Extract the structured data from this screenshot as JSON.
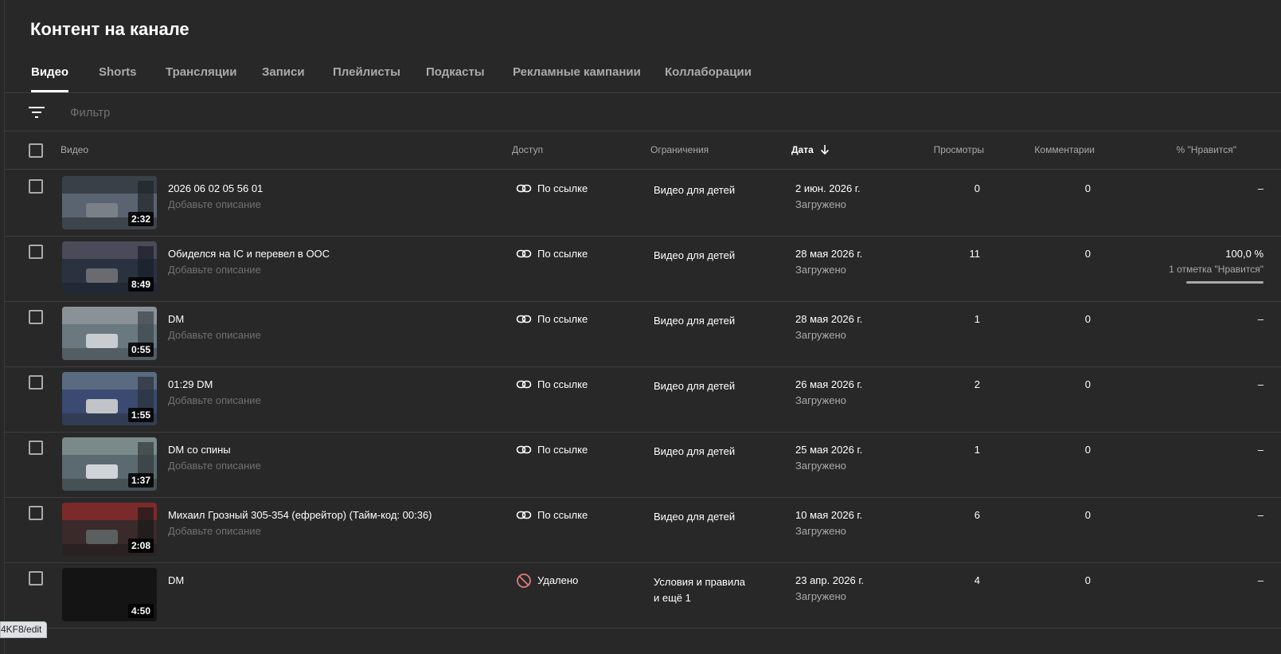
{
  "page": {
    "title": "Контент на канале"
  },
  "tabs": [
    {
      "label": "Видео",
      "active": true
    },
    {
      "label": "Shorts"
    },
    {
      "label": "Трансляции"
    },
    {
      "label": "Записи"
    },
    {
      "label": "Плейлисты"
    },
    {
      "label": "Подкасты"
    },
    {
      "label": "Рекламные кампании"
    },
    {
      "label": "Коллаборации"
    }
  ],
  "filter": {
    "placeholder": "Фильтр",
    "icon": "filter-list-icon"
  },
  "columns": {
    "video": "Видео",
    "access": "Доступ",
    "restrictions": "Ограничения",
    "date": "Дата",
    "views": "Просмотры",
    "comments": "Комментарии",
    "likes": "% \"Нравится\""
  },
  "sort": {
    "column": "date",
    "direction": "desc",
    "icon": "arrow-down-icon"
  },
  "colors": {
    "background": "#282828",
    "divider": "#3e3e3e",
    "secondary_text": "#aaaaaa",
    "removed_icon": "#e07a7a"
  },
  "videos": [
    {
      "title": "2026 06 02 05 56 01",
      "description": "Добавьте описание",
      "duration": "2:32",
      "access": "По ссылке",
      "access_icon": "link-icon",
      "restriction": "Видео для детей",
      "restriction_extra": "",
      "date": "2 июн. 2026 г.",
      "date_status": "Загружено",
      "views": "0",
      "comments": "0",
      "likes": "–",
      "likes_sub": ""
    },
    {
      "title": "Обиделся на IC и перевел в OOC",
      "description": "Добавьте описание",
      "duration": "8:49",
      "access": "По ссылке",
      "access_icon": "link-icon",
      "restriction": "Видео для детей",
      "restriction_extra": "",
      "date": "28 мая 2026 г.",
      "date_status": "Загружено",
      "views": "11",
      "comments": "0",
      "likes": "100,0 %",
      "likes_sub": "1 отметка \"Нравится\"",
      "like_ratio": 1.0
    },
    {
      "title": "DM",
      "description": "Добавьте описание",
      "duration": "0:55",
      "access": "По ссылке",
      "access_icon": "link-icon",
      "restriction": "Видео для детей",
      "restriction_extra": "",
      "date": "28 мая 2026 г.",
      "date_status": "Загружено",
      "views": "1",
      "comments": "0",
      "likes": "–",
      "likes_sub": ""
    },
    {
      "title": "01:29 DM",
      "description": "Добавьте описание",
      "duration": "1:55",
      "access": "По ссылке",
      "access_icon": "link-icon",
      "restriction": "Видео для детей",
      "restriction_extra": "",
      "date": "26 мая 2026 г.",
      "date_status": "Загружено",
      "views": "2",
      "comments": "0",
      "likes": "–",
      "likes_sub": ""
    },
    {
      "title": "DM со спины",
      "description": "Добавьте описание",
      "duration": "1:37",
      "access": "По ссылке",
      "access_icon": "link-icon",
      "restriction": "Видео для детей",
      "restriction_extra": "",
      "date": "25 мая 2026 г.",
      "date_status": "Загружено",
      "views": "1",
      "comments": "0",
      "likes": "–",
      "likes_sub": ""
    },
    {
      "title": "Михаил Грозный 305-354 (ефрейтор) (Тайм-код: 00:36)",
      "description": "Добавьте описание",
      "duration": "2:08",
      "access": "По ссылке",
      "access_icon": "link-icon",
      "restriction": "Видео для детей",
      "restriction_extra": "",
      "date": "10 мая 2026 г.",
      "date_status": "Загружено",
      "views": "6",
      "comments": "0",
      "likes": "–",
      "likes_sub": ""
    },
    {
      "title": "DM",
      "description": "",
      "duration": "4:50",
      "access": "Удалено",
      "access_icon": "blocked-icon",
      "restriction": "Условия и правила",
      "restriction_extra": "и ещё 1",
      "date": "23 апр. 2026 г.",
      "date_status": "Загружено",
      "views": "4",
      "comments": "0",
      "likes": "–",
      "likes_sub": ""
    }
  ],
  "statusbar": {
    "url": "4KF8/edit"
  }
}
